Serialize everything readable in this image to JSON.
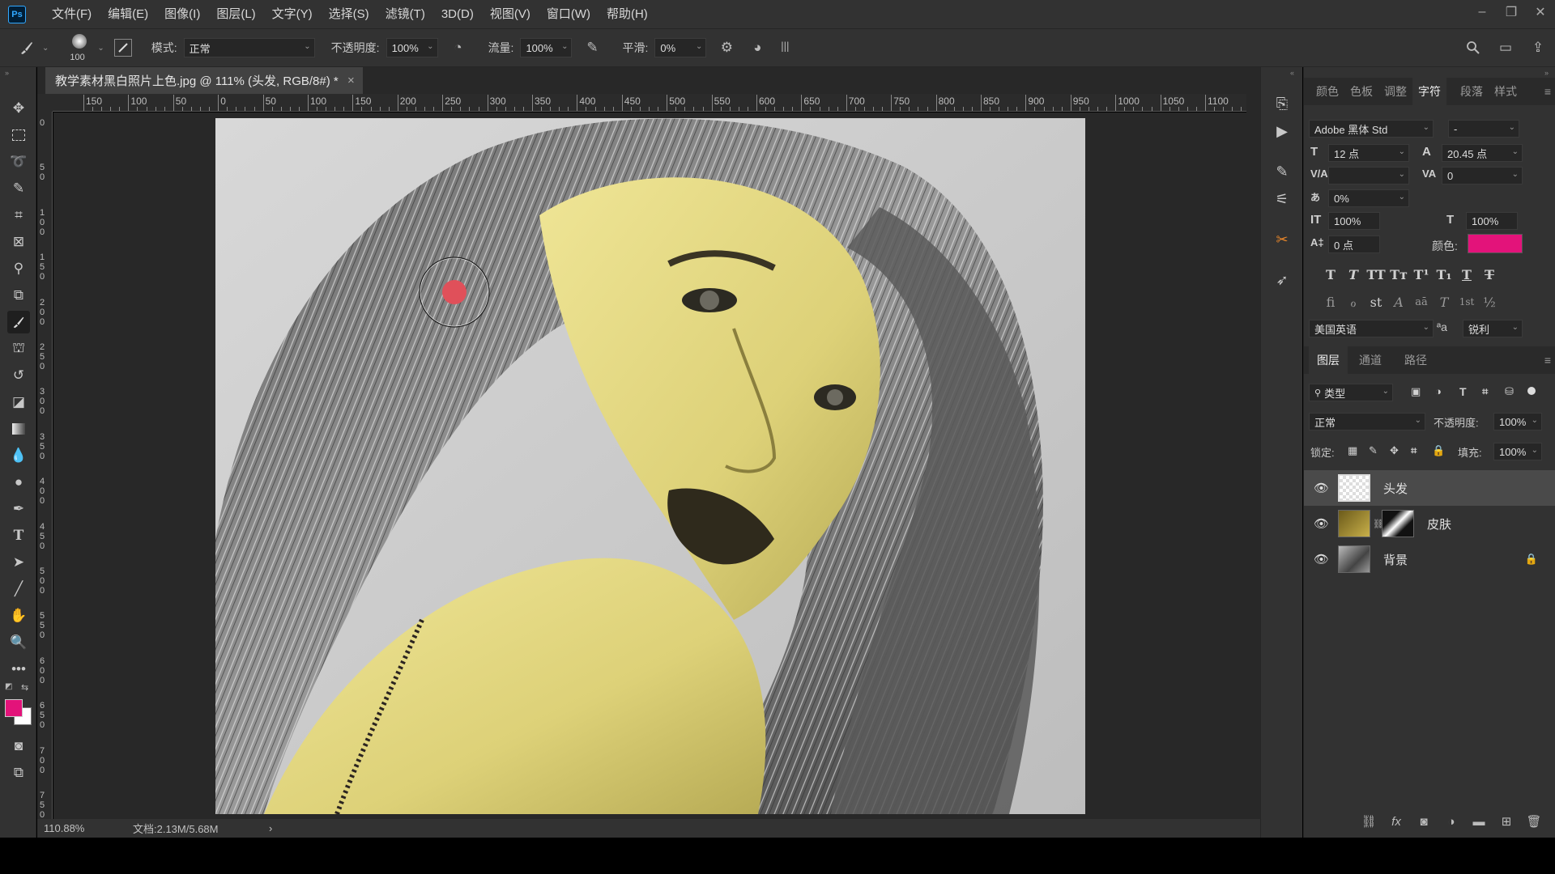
{
  "app": {
    "logo": "Ps"
  },
  "menu": [
    "文件(F)",
    "编辑(E)",
    "图像(I)",
    "图层(L)",
    "文字(Y)",
    "选择(S)",
    "滤镜(T)",
    "3D(D)",
    "视图(V)",
    "窗口(W)",
    "帮助(H)"
  ],
  "options": {
    "brush_size": "100",
    "mode_label": "模式:",
    "mode_value": "正常",
    "opacity_label": "不透明度:",
    "opacity_value": "100%",
    "flow_label": "流量:",
    "flow_value": "100%",
    "smooth_label": "平滑:",
    "smooth_value": "0%"
  },
  "document": {
    "tab_title": "教学素材黑白照片上色.jpg @ 111% (头发, RGB/8#) *",
    "close_glyph": "×"
  },
  "ruler": {
    "h_labels": [
      "150",
      "100",
      "50",
      "0",
      "50",
      "100",
      "150",
      "200",
      "250",
      "300",
      "350",
      "400",
      "450",
      "500",
      "550",
      "600",
      "650",
      "700",
      "750",
      "800",
      "850",
      "900",
      "950",
      "1000",
      "1050",
      "1100"
    ],
    "v_labels": [
      "0",
      "50",
      "100",
      "150",
      "200",
      "250",
      "300",
      "350",
      "400",
      "450",
      "500",
      "550",
      "600",
      "650",
      "700",
      "750"
    ]
  },
  "status": {
    "zoom": "110.88%",
    "doc_size": "文档:2.13M/5.68M",
    "arrow": "›"
  },
  "colors": {
    "foreground": "#e3137a",
    "background": "#ffffff",
    "skin_tint": "#e6dc82",
    "brush_dot": "#e0505a"
  },
  "character_panel": {
    "tabs": [
      "颜色",
      "色板",
      "调整",
      "字符",
      "段落",
      "样式"
    ],
    "active_tab": "字符",
    "font_family": "Adobe 黑体 Std",
    "font_style": "-",
    "font_size": "12 点",
    "leading": "20.45 点",
    "kerning": "",
    "tracking": "0",
    "tsume": "0%",
    "vscale": "100%",
    "hscale": "100%",
    "baseline": "0 点",
    "color_label": "颜色:",
    "color_value": "#e3137a",
    "type_styles": [
      "T",
      "T",
      "TT",
      "Tт",
      "T¹",
      "T₁",
      "T",
      "T"
    ],
    "opentype": [
      "fi",
      "ℴ",
      "st",
      "A",
      "aā",
      "T",
      "1st",
      "½"
    ],
    "language": "美国英语",
    "aa_icon": "ªa",
    "antialias": "锐利"
  },
  "layers_panel": {
    "tabs": [
      "图层",
      "通道",
      "路径"
    ],
    "active_tab": "图层",
    "filter_label": "类型",
    "blend_mode": "正常",
    "opacity_label": "不透明度:",
    "opacity_value": "100%",
    "lock_label": "锁定:",
    "fill_label": "填充:",
    "fill_value": "100%",
    "layers": [
      {
        "name": "头发",
        "selected": true,
        "locked": false
      },
      {
        "name": "皮肤",
        "selected": false,
        "locked": false
      },
      {
        "name": "背景",
        "selected": false,
        "locked": true
      }
    ]
  }
}
